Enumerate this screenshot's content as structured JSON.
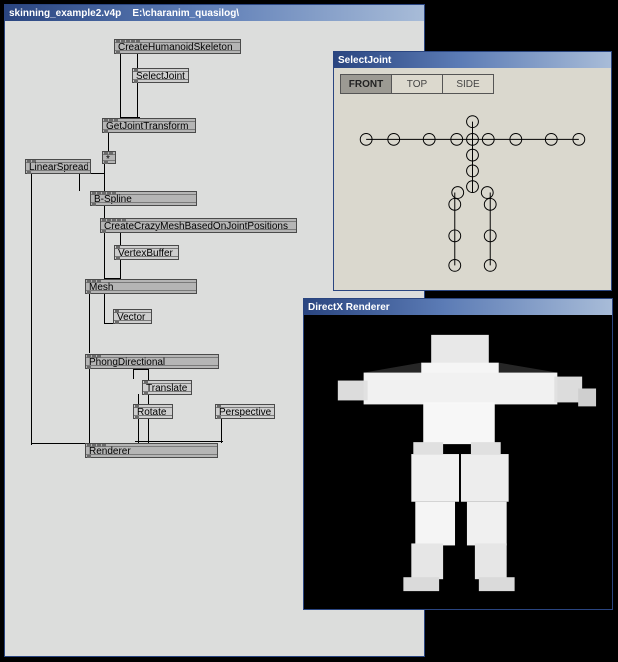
{
  "patch_window": {
    "title": "skinning_example2.v4p    E:\\charanim_quasilog\\",
    "nodes": {
      "createSkeleton": "CreateHumanoidSkeleton",
      "selectJoint": "SelectJoint",
      "getJointTransform": "GetJointTransform",
      "linearSpread": "LinearSpread",
      "star": "*",
      "bspline": "B-Spline",
      "createMesh": "CreateCrazyMeshBasedOnJointPositions",
      "vertexBuffer": "VertexBuffer",
      "mesh": "Mesh",
      "vector": "Vector",
      "phong": "PhongDirectional",
      "translate": "Translate",
      "rotate": "Rotate",
      "perspective": "Perspective",
      "renderer": "Renderer"
    }
  },
  "selectjoint_window": {
    "title": "SelectJoint",
    "tabs": {
      "front": "FRONT",
      "top": "TOP",
      "side": "SIDE"
    }
  },
  "renderer_window": {
    "title": "DirectX Renderer"
  }
}
